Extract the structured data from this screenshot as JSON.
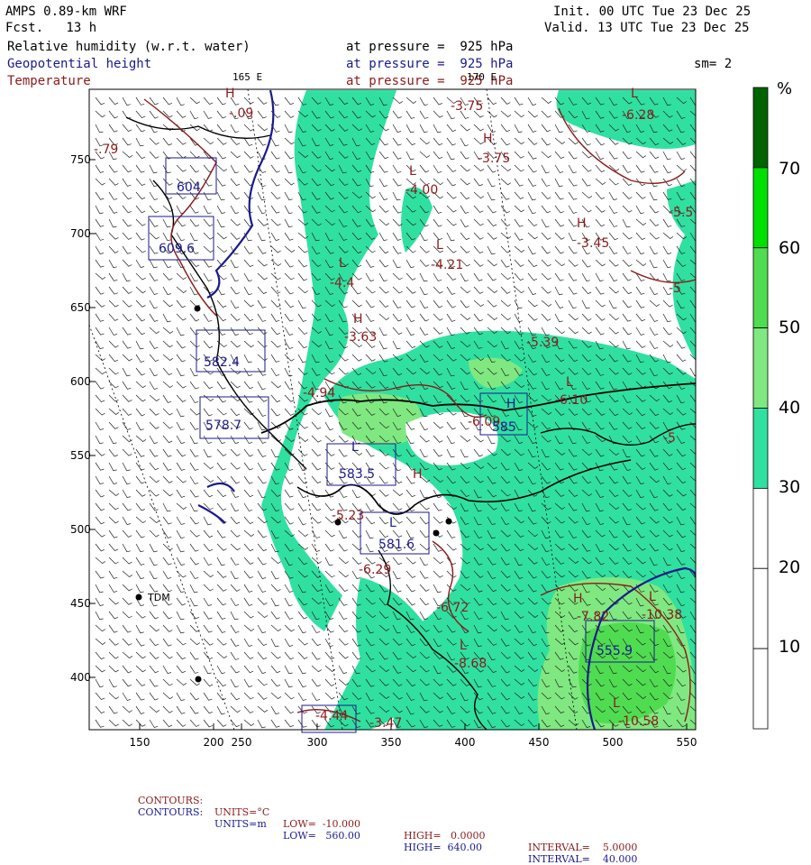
{
  "header": {
    "model": "AMPS 0.89-km WRF",
    "fcst": "Fcst.   13 h",
    "init": "Init. 00 UTC Tue 23 Dec 25",
    "valid": "Valid. 13 UTC Tue 23 Dec 25",
    "field1": "Relative humidity (w.r.t. water)",
    "field2": "Geopotential height",
    "field3": "Temperature",
    "pressure1": "at pressure =  925 hPa",
    "pressure2": "at pressure =  925 hPa",
    "pressure3": "at pressure =  925 hPa",
    "smoothing": "sm= 2",
    "lon_label_1": "165 E",
    "lon_label_2": "170 E"
  },
  "legend": {
    "unit": "%",
    "labels": [
      "70",
      "60",
      "50",
      "40",
      "30",
      "20",
      "10"
    ],
    "colors": [
      "#006400",
      "#00e000",
      "#50dc50",
      "#80e880",
      "#30e0a0",
      "#ffffff",
      "#ffffff",
      "#ffffff"
    ]
  },
  "axes": {
    "x_ticks": [
      "150",
      "200",
      "250",
      "300",
      "350",
      "400",
      "450",
      "500",
      "550"
    ],
    "y_ticks": [
      "750",
      "700",
      "650",
      "600",
      "550",
      "500",
      "450",
      "400"
    ]
  },
  "stations": [
    {
      "name": "TDM"
    }
  ],
  "map_labels": {
    "temp_values": [
      "-3.75",
      "-6.28",
      "-3.75",
      "-4.00",
      "-3.45",
      "-4.21",
      "-4.4",
      "-3.63",
      "-5.39",
      "-4.94",
      "-6.10",
      "-5",
      "-6.09",
      "-5.23",
      "-6.29",
      "-6.72",
      "-8.68",
      "-7.82",
      "-10.38",
      "-10.58",
      "-4.44",
      "-3.47",
      "-.09",
      "-.79",
      "-5.5",
      "-5"
    ],
    "height_values": [
      "604",
      "609.6",
      "582.4",
      "578.7",
      "583.5",
      "581.6",
      "585",
      "555.9"
    ],
    "hl": [
      "H",
      "L"
    ]
  },
  "footer": {
    "row1": {
      "label": "CONTOURS:",
      "units": "UNITS=°C",
      "low": "LOW=  -10.000",
      "high": "HIGH=   0.0000",
      "interval": "INTERVAL=    5.0000"
    },
    "row2": {
      "label": "CONTOURS:",
      "units": "UNITS=m",
      "low": "LOW=   560.00",
      "high": "HIGH=  640.00",
      "interval": "INTERVAL=    40.000"
    },
    "colors": {
      "temp": "#8b1a1a",
      "height": "#1a1a8c"
    }
  }
}
